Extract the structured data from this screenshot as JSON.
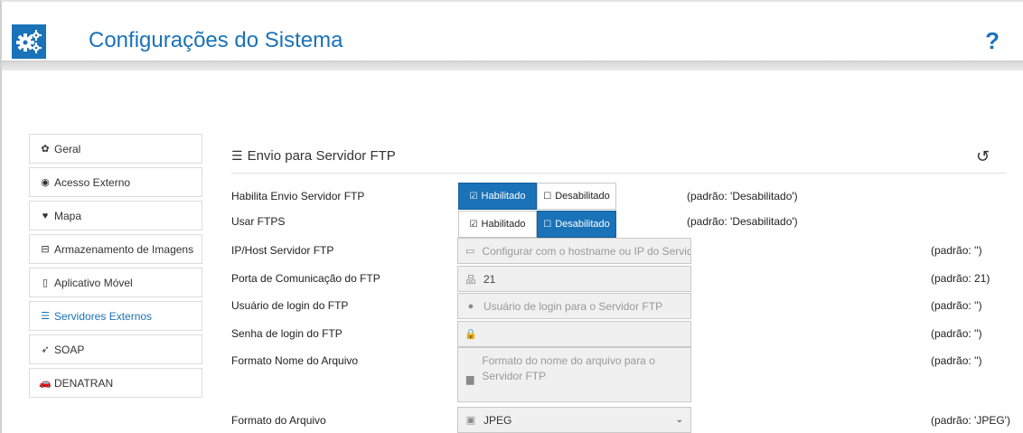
{
  "header": {
    "title": "Configurações do Sistema",
    "help": "?"
  },
  "sidebar": {
    "items": [
      {
        "label": "Geral",
        "icon": "gears-icon"
      },
      {
        "label": "Acesso Externo",
        "icon": "globe-icon"
      },
      {
        "label": "Mapa",
        "icon": "map-marker-icon"
      },
      {
        "label": "Armazenamento de Imagens",
        "icon": "hdd-icon"
      },
      {
        "label": "Aplicativo Móvel",
        "icon": "mobile-icon"
      },
      {
        "label": "Servidores Externos",
        "icon": "server-icon",
        "active": true
      },
      {
        "label": "SOAP",
        "icon": "paper-plane-icon"
      },
      {
        "label": "DENATRAN",
        "icon": "car-icon"
      }
    ]
  },
  "panel": {
    "title": "Envio para Servidor FTP"
  },
  "rows": {
    "habilita": {
      "label": "Habilita Envio Servidor FTP",
      "on": "Habilitado",
      "off": "Desabilitado",
      "selected": "Habilitado",
      "default": "(padrão: 'Desabilitado')"
    },
    "ftps": {
      "label": "Usar FTPS",
      "on": "Habilitado",
      "off": "Desabilitado",
      "selected": "Desabilitado",
      "default": "(padrão: 'Desabilitado')"
    },
    "host": {
      "label": "IP/Host Servidor FTP",
      "placeholder": "Configurar com o hostname ou IP do Servidc",
      "default": "(padrão: '')"
    },
    "porta": {
      "label": "Porta de Comunicação do FTP",
      "value": "21",
      "default": "(padrão: 21)"
    },
    "usuario": {
      "label": "Usuário de login do FTP",
      "placeholder": "Usuário de login para o Servidor FTP",
      "default": "(padrão: '')"
    },
    "senha": {
      "label": "Senha de login do FTP",
      "value": "",
      "default": "(padrão: '')"
    },
    "formato_nome": {
      "label": "Formato Nome do Arquivo",
      "placeholder": "Formato do nome do arquivo para o Servidor FTP",
      "default": "(padrão: '')"
    },
    "formato_arquivo": {
      "label": "Formato do Arquivo",
      "value": "JPEG",
      "default": "(padrão: 'JPEG')"
    }
  },
  "colors": {
    "accent": "#1a72b8"
  }
}
